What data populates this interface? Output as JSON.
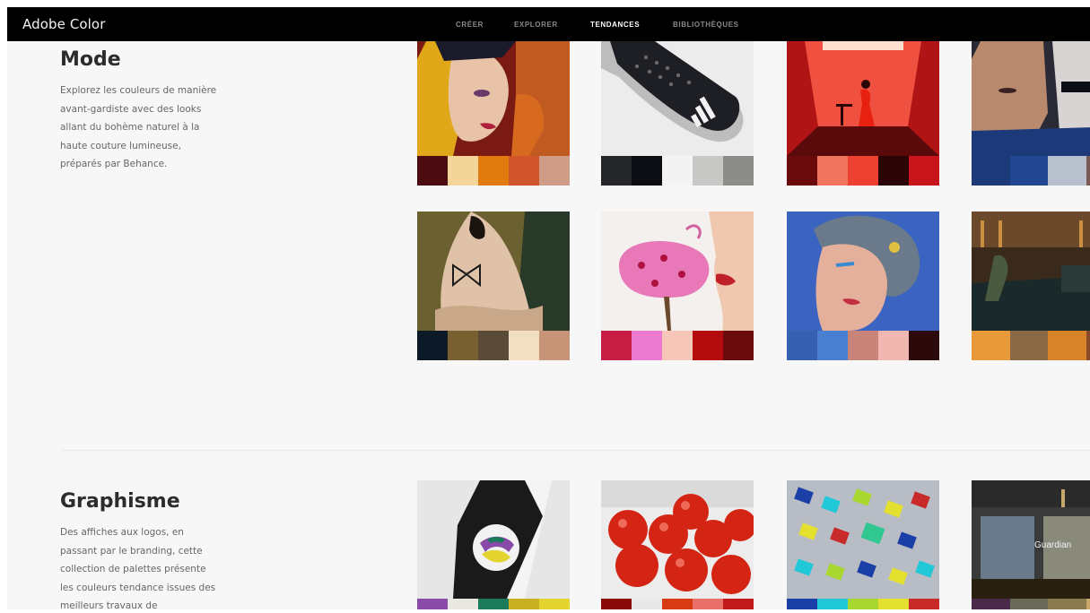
{
  "app": {
    "title": "Adobe Color"
  },
  "nav": {
    "tabs": [
      {
        "label": "CRÉER",
        "active": false
      },
      {
        "label": "EXPLORER",
        "active": false
      },
      {
        "label": "TENDANCES",
        "active": true
      },
      {
        "label": "BIBLIOTHÈQUES",
        "active": false
      }
    ]
  },
  "sections": [
    {
      "title": "Mode",
      "description": "Explorez les couleurs de manière avant-gardiste avec des looks allant du bohème naturel à la haute couture lumineuse, préparés par Behance.",
      "cards": [
        {
          "subject": "woman-yellow-hood",
          "swatches": [
            "#4a0c10",
            "#f3d59a",
            "#e07b10",
            "#d0552a",
            "#cf9c88"
          ]
        },
        {
          "subject": "adidas-sneaker",
          "swatches": [
            "#24262a",
            "#0b0d12",
            "#f3f3f3",
            "#c8c8c6",
            "#8c8c88"
          ]
        },
        {
          "subject": "red-room",
          "swatches": [
            "#6a0a0c",
            "#f07560",
            "#ee4030",
            "#2a0406",
            "#c8141a"
          ]
        },
        {
          "subject": "two-faces",
          "swatches": [
            "#1c3a7a",
            "#234690",
            "#b7c0cc",
            "#7a5a52"
          ]
        },
        {
          "subject": "woman-butterfly",
          "swatches": [
            "#0c1a28",
            "#786030",
            "#5a4a38",
            "#f2dfc2",
            "#c89478"
          ]
        },
        {
          "subject": "cake-fork-lips",
          "swatches": [
            "#c81e46",
            "#ec7ad0",
            "#f6c6b8",
            "#b40c0c",
            "#6a0a0c"
          ]
        },
        {
          "subject": "woman-blue-hair",
          "swatches": [
            "#3660b0",
            "#4a7ed0",
            "#c88478",
            "#f0b8b0",
            "#2c0a0c"
          ]
        },
        {
          "subject": "dark-interior",
          "swatches": [
            "#e89a3a",
            "#8a6a44",
            "#d8822a",
            "#8a4a2a"
          ]
        }
      ]
    },
    {
      "title": "Graphisme",
      "description": "Des affiches aux logos, en passant par le branding, cette collection de palettes présente les couleurs tendance issues des meilleurs travaux de",
      "cards": [
        {
          "subject": "bottle-label",
          "swatches": [
            "#8a4aa8",
            "#e8e8e0",
            "#1a7a5a",
            "#c8b020",
            "#e4d430"
          ]
        },
        {
          "subject": "tomatoes",
          "swatches": [
            "#8a0a0a",
            "#e8e8e8",
            "#d83a14",
            "#e87068",
            "#c01a1a"
          ]
        },
        {
          "subject": "toy-blocks",
          "swatches": [
            "#1a40a8",
            "#20c8d8",
            "#a8d830",
            "#e4e030",
            "#c82a2a"
          ]
        },
        {
          "subject": "office-glass",
          "swatches": [
            "#4a2a4a",
            "#6a6a5a",
            "#8a7a50",
            "#c8a86a"
          ],
          "sign": "Guardian"
        }
      ]
    }
  ]
}
